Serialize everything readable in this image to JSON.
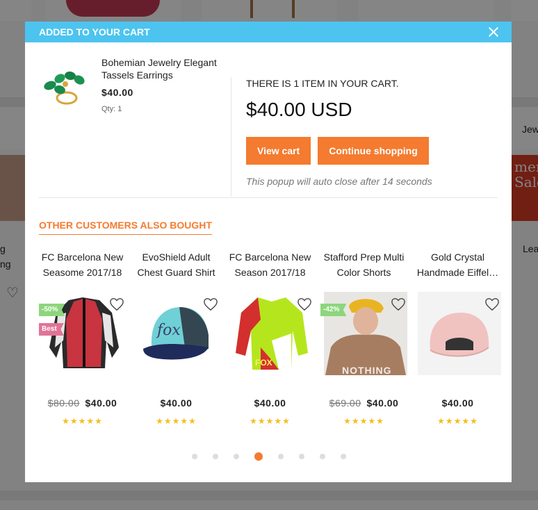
{
  "background": {
    "right_tab_label": "Jew",
    "left_item_line1": "g",
    "left_item_line2": "ng",
    "right_item_label": "Lea",
    "banner_line1": "mer",
    "banner_line2": "Sale"
  },
  "modal": {
    "header_title": "ADDED TO YOUR CART",
    "close_icon": "close-icon",
    "product": {
      "name": "Bohemian Jewelry Elegant Tassels Earrings",
      "price": "$40.00",
      "qty": "Qty: 1"
    },
    "summary": {
      "count_text": "THERE IS 1 ITEM IN YOUR CART.",
      "total": "$40.00 USD",
      "view_cart_label": "View cart",
      "continue_label": "Continue shopping",
      "auto_close_text": "This popup will auto close after 14 seconds"
    },
    "also_bought": {
      "title": "OTHER CUSTOMERS ALSO BOUGHT",
      "items": [
        {
          "name": "FC Barcelona New Seasome 2017/18",
          "old_price": "$80.00",
          "price": "$40.00",
          "sale_badge": "-50%",
          "best_badge": "Best",
          "stars": "★★★★★",
          "rating": 5
        },
        {
          "name": "EvoShield Adult Chest Guard Shirt",
          "old_price": "",
          "price": "$40.00",
          "sale_badge": "",
          "best_badge": "",
          "stars": "★★★★★",
          "rating": 5
        },
        {
          "name": "FC Barcelona New Season 2017/18",
          "old_price": "",
          "price": "$40.00",
          "sale_badge": "",
          "best_badge": "",
          "stars": "★★★★★",
          "rating": 5
        },
        {
          "name": "Stafford Prep Multi Color Shorts",
          "old_price": "$69.00",
          "price": "$40.00",
          "sale_badge": "-42%",
          "best_badge": "",
          "stars": "★★★★★",
          "rating": 5
        },
        {
          "name": "Gold Crystal Handmade Eiffel…",
          "old_price": "",
          "price": "$40.00",
          "sale_badge": "",
          "best_badge": "",
          "stars": "★★★★★",
          "rating": 5
        }
      ],
      "hoodie_text": "NOTHING",
      "jacket_text": "FOX",
      "cap_text": "fox",
      "pagination": {
        "total": 8,
        "active_index": 3
      }
    }
  },
  "colors": {
    "header": "#4cc4ef",
    "accent": "#f47b30",
    "sale_badge": "#8cd67c",
    "best_badge": "#e27396",
    "stars": "#f5bd1d"
  }
}
